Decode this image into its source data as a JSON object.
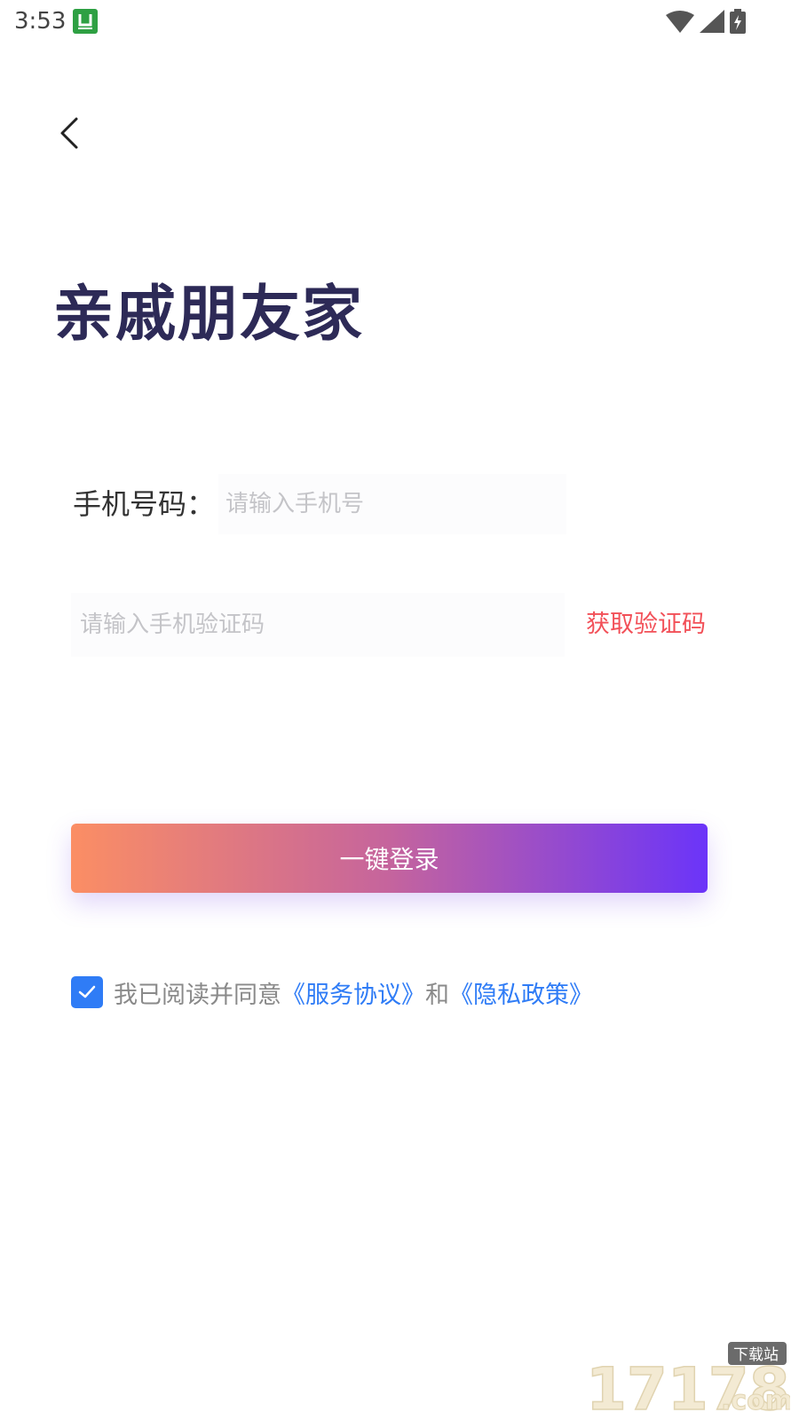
{
  "status_bar": {
    "time": "3:53",
    "app_icon": "u-app-icon",
    "icons": [
      "wifi-icon",
      "signal-icon",
      "battery-charging-icon"
    ]
  },
  "nav": {
    "back_icon": "chevron-left-icon"
  },
  "title": "亲戚朋友家",
  "form": {
    "phone_label": "手机号码：",
    "phone_placeholder": "请输入手机号",
    "phone_value": "",
    "code_placeholder": "请输入手机验证码",
    "code_value": "",
    "get_code_label": "获取验证码"
  },
  "login_button_label": "一键登录",
  "agreement": {
    "checked": true,
    "prefix": "我已阅读并同意",
    "service_link": "《服务协议》",
    "conjunction": "和",
    "privacy_link": "《隐私政策》"
  },
  "watermark": {
    "number": "17178",
    "badge": "下载站",
    "domain": ".com"
  },
  "colors": {
    "title": "#2d2a57",
    "get_code": "#f25058",
    "link": "#2f7cf6",
    "checkbox": "#2f7cf6",
    "gradient_start": "#fb8e64",
    "gradient_end": "#6b34f9"
  }
}
